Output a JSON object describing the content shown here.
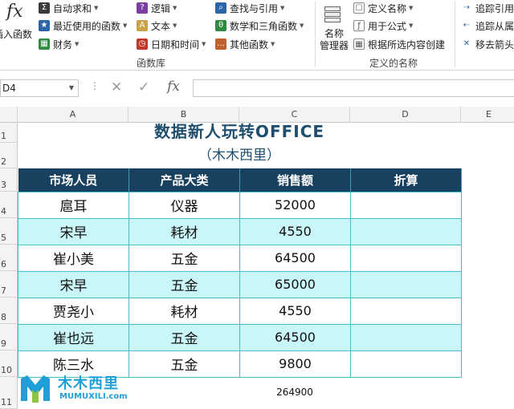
{
  "ribbon": {
    "insert_function": {
      "icon": "fx",
      "label": "插入函数"
    },
    "functions": [
      {
        "label": "自动求和",
        "icon": "sum-icon",
        "glyph": "Σ",
        "color": "#3a3a3a"
      },
      {
        "label": "最近使用的函数",
        "icon": "star-book-icon",
        "glyph": "★",
        "color": "#2b64a8"
      },
      {
        "label": "财务",
        "icon": "finance-book-icon",
        "glyph": "▦",
        "color": "#2d8a3e"
      },
      {
        "label": "逻辑",
        "icon": "logic-book-icon",
        "glyph": "?",
        "color": "#7a3fa0"
      },
      {
        "label": "文本",
        "icon": "text-book-icon",
        "glyph": "A",
        "color": "#c9a24a"
      },
      {
        "label": "日期和时间",
        "icon": "datetime-book-icon",
        "glyph": "◷",
        "color": "#c0392b"
      },
      {
        "label": "查找与引用",
        "icon": "lookup-book-icon",
        "glyph": "⌕",
        "color": "#2b64a8"
      },
      {
        "label": "数学和三角函数",
        "icon": "math-book-icon",
        "glyph": "θ",
        "color": "#2d8a3e"
      },
      {
        "label": "其他函数",
        "icon": "more-book-icon",
        "glyph": "…",
        "color": "#c0602b"
      }
    ],
    "function_library_label": "函数库",
    "name_manager": "名称\n管理器",
    "defined_names": [
      {
        "label": "定义名称",
        "icon": "define-name-icon"
      },
      {
        "label": "用于公式",
        "icon": "use-in-formula-icon"
      },
      {
        "label": "根据所选内容创建",
        "icon": "create-from-selection-icon"
      }
    ],
    "defined_names_label": "定义的名称",
    "audit": [
      {
        "label": "追踪引用",
        "icon": "trace-precedents-icon"
      },
      {
        "label": "追踪从属",
        "icon": "trace-dependents-icon"
      },
      {
        "label": "移去箭头",
        "icon": "remove-arrows-icon"
      }
    ]
  },
  "formula_bar": {
    "name_box": "D4",
    "fx": "fx",
    "formula": ""
  },
  "columns": [
    "A",
    "B",
    "C",
    "D",
    "E"
  ],
  "rows": [
    "1",
    "2",
    "3",
    "4",
    "5",
    "6",
    "7",
    "8",
    "9",
    "10",
    "11"
  ],
  "sheet": {
    "title": "数据新人玩转OFFICE",
    "subtitle": "（木木西里）",
    "headers": [
      "市场人员",
      "产品大类",
      "销售额",
      "折算"
    ],
    "data": [
      [
        "扈耳",
        "仪器",
        "52000",
        ""
      ],
      [
        "宋早",
        "耗材",
        "4550",
        ""
      ],
      [
        "崔小美",
        "五金",
        "64500",
        ""
      ],
      [
        "宋早",
        "五金",
        "65000",
        ""
      ],
      [
        "贾尧小",
        "耗材",
        "4550",
        ""
      ],
      [
        "崔也远",
        "五金",
        "64500",
        ""
      ],
      [
        "陈三水",
        "五金",
        "9800",
        ""
      ]
    ],
    "total": "264900"
  },
  "logo": {
    "text": "木木西里",
    "sub": "MUMUXILI.com"
  }
}
